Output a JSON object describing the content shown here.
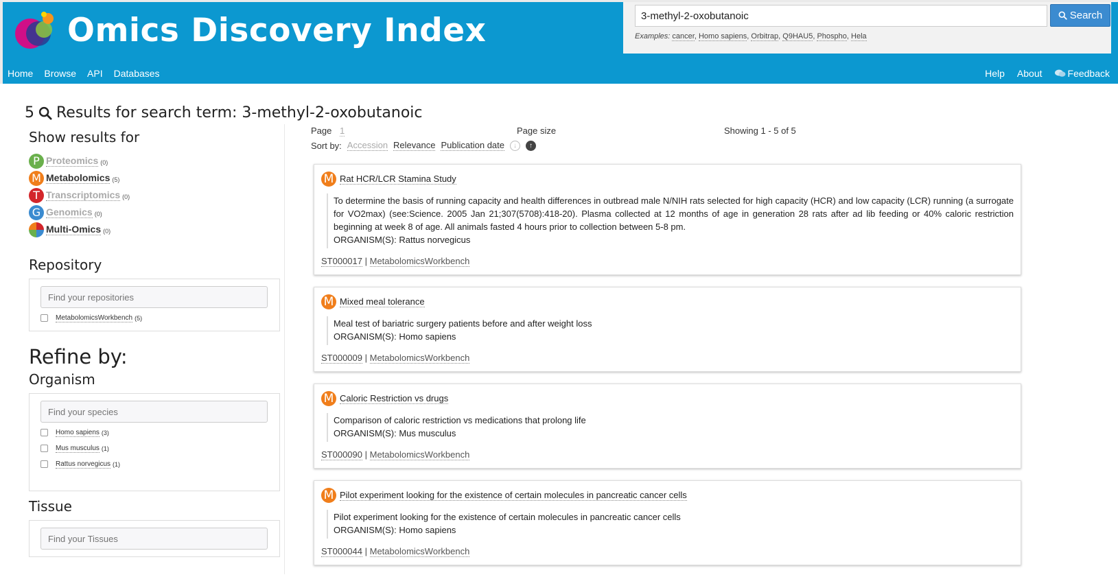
{
  "header": {
    "brand": "Omics Discovery Index",
    "search": {
      "value": "3-methyl-2-oxobutanoic",
      "button_label": "Search"
    },
    "examples_label": "Examples:",
    "examples": [
      "cancer",
      "Homo sapiens",
      "Orbitrap",
      "Q9HAU5",
      "Phospho",
      "Hela"
    ],
    "nav_left": [
      "Home",
      "Browse",
      "API",
      "Databases"
    ],
    "nav_right": [
      "Help",
      "About",
      "Feedback"
    ]
  },
  "results": {
    "count": "5",
    "label": "Results for search term: 3-methyl-2-oxobutanoic"
  },
  "sidebar": {
    "show_results_heading": "Show results for",
    "omics": [
      {
        "letter": "P",
        "name": "Proteomics",
        "count": "(0)",
        "color": "#6ab04c"
      },
      {
        "letter": "M",
        "name": "Metabolomics",
        "count": "(5)",
        "color": "#f07e1b"
      },
      {
        "letter": "T",
        "name": "Transcriptomics",
        "count": "(0)",
        "color": "#d3262b"
      },
      {
        "letter": "G",
        "name": "Genomics",
        "count": "(0)",
        "color": "#3b8bd0"
      },
      {
        "letter": "",
        "name": "Multi-Omics",
        "count": "(0)",
        "color": "#888888"
      }
    ],
    "repository_heading": "Repository",
    "repository_placeholder": "Find your repositories",
    "repositories": [
      {
        "name": "MetabolomicsWorkbench",
        "count": "(5)"
      }
    ],
    "refine_heading": "Refine by:",
    "organism_heading": "Organism",
    "organism_placeholder": "Find your species",
    "organisms": [
      {
        "name": "Homo sapiens",
        "count": "(3)"
      },
      {
        "name": "Mus musculus",
        "count": "(1)"
      },
      {
        "name": "Rattus norvegicus",
        "count": "(1)"
      }
    ],
    "tissue_heading": "Tissue",
    "tissue_placeholder": "Find your Tissues"
  },
  "toolbar": {
    "page_label": "Page",
    "page_number": "1",
    "page_size_label": "Page size",
    "showing": "Showing 1 - 5 of 5",
    "sort_by_label": "Sort by:",
    "sort_options": [
      "Accession",
      "Relevance",
      "Publication date"
    ]
  },
  "cards": [
    {
      "letter": "M",
      "title": "Rat HCR/LCR Stamina Study",
      "description": "To determine the basis of running capacity and health differences in outbread male N/NIH rats selected for high capacity (HCR) and low capacity (LCR) running (a surrogate for VO2max) (see:Science. 2005 Jan 21;307(5708):418-20). Plasma collected at 12 months of age in generation 28 rats after ad lib feeding or 40% caloric restriction beginning at week 8 of age. All animals fasted 4 hours prior to collection between 5-8 pm.",
      "organism": "ORGANISM(S): Rattus norvegicus",
      "accession": "ST000017",
      "repository": "MetabolomicsWorkbench"
    },
    {
      "letter": "M",
      "title": "Mixed meal tolerance",
      "description": "Meal test of bariatric surgery patients before and after weight loss",
      "organism": "ORGANISM(S): Homo sapiens",
      "accession": "ST000009",
      "repository": "MetabolomicsWorkbench"
    },
    {
      "letter": "M",
      "title": "Caloric Restriction vs drugs",
      "description": "Comparison of caloric restriction vs medications that prolong life",
      "organism": "ORGANISM(S): Mus musculus",
      "accession": "ST000090",
      "repository": "MetabolomicsWorkbench"
    },
    {
      "letter": "M",
      "title": "Pilot experiment looking for the existence of certain molecules in pancreatic cancer cells",
      "description": "Pilot experiment looking for the existence of certain molecules in pancreatic cancer cells",
      "organism": "ORGANISM(S): Homo sapiens",
      "accession": "ST000044",
      "repository": "MetabolomicsWorkbench"
    }
  ]
}
